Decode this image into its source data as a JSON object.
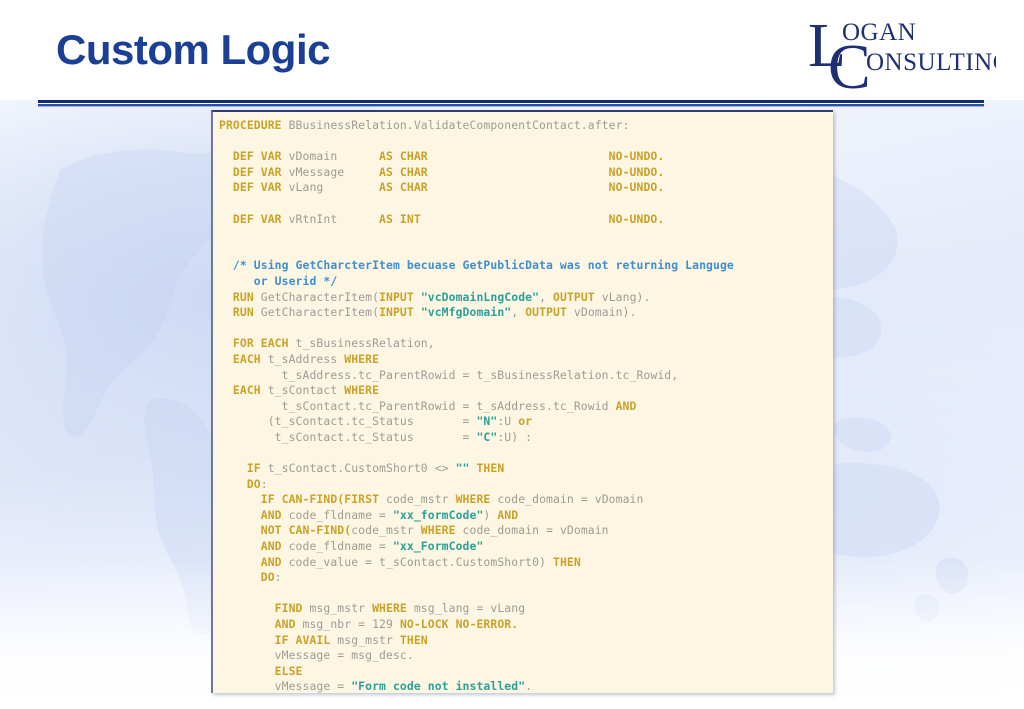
{
  "slide": {
    "title": "Custom Logic",
    "title_color": "#1b3f94",
    "background_color": "#ffffff"
  },
  "logo": {
    "name": "logan-consulting-logo",
    "line1": "OGAN",
    "line2": "ONSULTING",
    "drop_cap_1": "L",
    "drop_cap_2": "C",
    "color": "#1f2f73"
  },
  "code_panel": {
    "background_color": "#fdf6e3",
    "keyword_color": "#c9a227",
    "string_color": "#2aa198",
    "comment_color": "#3f8fd0",
    "identifier_color": "#9d9d95",
    "lines": [
      [
        {
          "t": "PROCEDURE ",
          "c": "kw"
        },
        {
          "t": "BBusinessRelation.ValidateComponentContact.after:",
          "c": "id"
        }
      ],
      [],
      [
        {
          "t": "  ",
          "c": "pun"
        },
        {
          "t": "DEF VAR ",
          "c": "kw"
        },
        {
          "t": "vDomain      ",
          "c": "id"
        },
        {
          "t": "AS CHAR",
          "c": "kw"
        },
        {
          "t": "                          ",
          "c": "pun"
        },
        {
          "t": "NO-UNDO.",
          "c": "kw"
        }
      ],
      [
        {
          "t": "  ",
          "c": "pun"
        },
        {
          "t": "DEF VAR ",
          "c": "kw"
        },
        {
          "t": "vMessage     ",
          "c": "id"
        },
        {
          "t": "AS CHAR",
          "c": "kw"
        },
        {
          "t": "                          ",
          "c": "pun"
        },
        {
          "t": "NO-UNDO.",
          "c": "kw"
        }
      ],
      [
        {
          "t": "  ",
          "c": "pun"
        },
        {
          "t": "DEF VAR ",
          "c": "kw"
        },
        {
          "t": "vLang        ",
          "c": "id"
        },
        {
          "t": "AS CHAR",
          "c": "kw"
        },
        {
          "t": "                          ",
          "c": "pun"
        },
        {
          "t": "NO-UNDO.",
          "c": "kw"
        }
      ],
      [],
      [
        {
          "t": "  ",
          "c": "pun"
        },
        {
          "t": "DEF VAR ",
          "c": "kw"
        },
        {
          "t": "vRtnInt      ",
          "c": "id"
        },
        {
          "t": "AS INT",
          "c": "kw"
        },
        {
          "t": "                           ",
          "c": "pun"
        },
        {
          "t": "NO-UNDO.",
          "c": "kw"
        }
      ],
      [],
      [],
      [
        {
          "t": "  /* Using GetCharcterItem becuase GetPublicData was not returning Languge",
          "c": "cmt"
        }
      ],
      [
        {
          "t": "     or Userid */",
          "c": "cmt"
        }
      ],
      [
        {
          "t": "  ",
          "c": "pun"
        },
        {
          "t": "RUN ",
          "c": "kw"
        },
        {
          "t": "GetCharacterItem(",
          "c": "id"
        },
        {
          "t": "INPUT ",
          "c": "kw"
        },
        {
          "t": "\"vcDomainLngCode\"",
          "c": "str"
        },
        {
          "t": ", ",
          "c": "id"
        },
        {
          "t": "OUTPUT ",
          "c": "kw"
        },
        {
          "t": "vLang).",
          "c": "id"
        }
      ],
      [
        {
          "t": "  ",
          "c": "pun"
        },
        {
          "t": "RUN ",
          "c": "kw"
        },
        {
          "t": "GetCharacterItem(",
          "c": "id"
        },
        {
          "t": "INPUT ",
          "c": "kw"
        },
        {
          "t": "\"vcMfgDomain\"",
          "c": "str"
        },
        {
          "t": ", ",
          "c": "id"
        },
        {
          "t": "OUTPUT ",
          "c": "kw"
        },
        {
          "t": "vDomain).",
          "c": "id"
        }
      ],
      [],
      [
        {
          "t": "  ",
          "c": "pun"
        },
        {
          "t": "FOR EACH ",
          "c": "kw"
        },
        {
          "t": "t_sBusinessRelation,",
          "c": "id"
        }
      ],
      [
        {
          "t": "  ",
          "c": "pun"
        },
        {
          "t": "EACH ",
          "c": "kw"
        },
        {
          "t": "t_sAddress ",
          "c": "id"
        },
        {
          "t": "WHERE",
          "c": "kw"
        }
      ],
      [
        {
          "t": "         t_sAddress.tc_ParentRowid = t_sBusinessRelation.tc_Rowid,",
          "c": "id"
        }
      ],
      [
        {
          "t": "  ",
          "c": "pun"
        },
        {
          "t": "EACH ",
          "c": "kw"
        },
        {
          "t": "t_sContact ",
          "c": "id"
        },
        {
          "t": "WHERE",
          "c": "kw"
        }
      ],
      [
        {
          "t": "         t_sContact.tc_ParentRowid = t_sAddress.tc_Rowid ",
          "c": "id"
        },
        {
          "t": "AND",
          "c": "kw"
        }
      ],
      [
        {
          "t": "       (t_sContact.tc_Status       = ",
          "c": "id"
        },
        {
          "t": "\"N\"",
          "c": "str"
        },
        {
          "t": ":U ",
          "c": "id"
        },
        {
          "t": "or",
          "c": "kw"
        }
      ],
      [
        {
          "t": "        t_sContact.tc_Status       = ",
          "c": "id"
        },
        {
          "t": "\"C\"",
          "c": "str"
        },
        {
          "t": ":U) :",
          "c": "id"
        }
      ],
      [],
      [
        {
          "t": "    ",
          "c": "pun"
        },
        {
          "t": "IF ",
          "c": "kw"
        },
        {
          "t": "t_sContact.CustomShort0 <> ",
          "c": "id"
        },
        {
          "t": "\"\" ",
          "c": "str"
        },
        {
          "t": "THEN",
          "c": "kw"
        }
      ],
      [
        {
          "t": "    ",
          "c": "pun"
        },
        {
          "t": "DO",
          "c": "kw"
        },
        {
          "t": ":",
          "c": "id"
        }
      ],
      [
        {
          "t": "      ",
          "c": "pun"
        },
        {
          "t": "IF CAN-FIND(FIRST ",
          "c": "kw"
        },
        {
          "t": "code_mstr ",
          "c": "id"
        },
        {
          "t": "WHERE ",
          "c": "kw"
        },
        {
          "t": "code_domain = vDomain",
          "c": "id"
        }
      ],
      [
        {
          "t": "      ",
          "c": "pun"
        },
        {
          "t": "AND ",
          "c": "kw"
        },
        {
          "t": "code_fldname = ",
          "c": "id"
        },
        {
          "t": "\"xx_formCode\"",
          "c": "str"
        },
        {
          "t": ") ",
          "c": "id"
        },
        {
          "t": "AND",
          "c": "kw"
        }
      ],
      [
        {
          "t": "      ",
          "c": "pun"
        },
        {
          "t": "NOT CAN-FIND(",
          "c": "kw"
        },
        {
          "t": "code_mstr ",
          "c": "id"
        },
        {
          "t": "WHERE ",
          "c": "kw"
        },
        {
          "t": "code_domain = vDomain",
          "c": "id"
        }
      ],
      [
        {
          "t": "      ",
          "c": "pun"
        },
        {
          "t": "AND ",
          "c": "kw"
        },
        {
          "t": "code_fldname = ",
          "c": "id"
        },
        {
          "t": "\"xx_FormCode\"",
          "c": "str"
        }
      ],
      [
        {
          "t": "      ",
          "c": "pun"
        },
        {
          "t": "AND ",
          "c": "kw"
        },
        {
          "t": "code_value = t_sContact.CustomShort0) ",
          "c": "id"
        },
        {
          "t": "THEN",
          "c": "kw"
        }
      ],
      [
        {
          "t": "      ",
          "c": "pun"
        },
        {
          "t": "DO",
          "c": "kw"
        },
        {
          "t": ":",
          "c": "id"
        }
      ],
      [],
      [
        {
          "t": "        ",
          "c": "pun"
        },
        {
          "t": "FIND ",
          "c": "kw"
        },
        {
          "t": "msg_mstr ",
          "c": "id"
        },
        {
          "t": "WHERE ",
          "c": "kw"
        },
        {
          "t": "msg_lang = vLang",
          "c": "id"
        }
      ],
      [
        {
          "t": "        ",
          "c": "pun"
        },
        {
          "t": "AND ",
          "c": "kw"
        },
        {
          "t": "msg_nbr = 129 ",
          "c": "id"
        },
        {
          "t": "NO-LOCK NO-ERROR.",
          "c": "kw"
        }
      ],
      [
        {
          "t": "        ",
          "c": "pun"
        },
        {
          "t": "IF AVAIL ",
          "c": "kw"
        },
        {
          "t": "msg_mstr ",
          "c": "id"
        },
        {
          "t": "THEN",
          "c": "kw"
        }
      ],
      [
        {
          "t": "        vMessage = msg_desc.",
          "c": "id"
        }
      ],
      [
        {
          "t": "        ",
          "c": "pun"
        },
        {
          "t": "ELSE",
          "c": "kw"
        }
      ],
      [
        {
          "t": "        vMessage = ",
          "c": "id"
        },
        {
          "t": "\"Form code not installed\"",
          "c": "str"
        },
        {
          "t": ".",
          "c": "id"
        }
      ]
    ]
  }
}
